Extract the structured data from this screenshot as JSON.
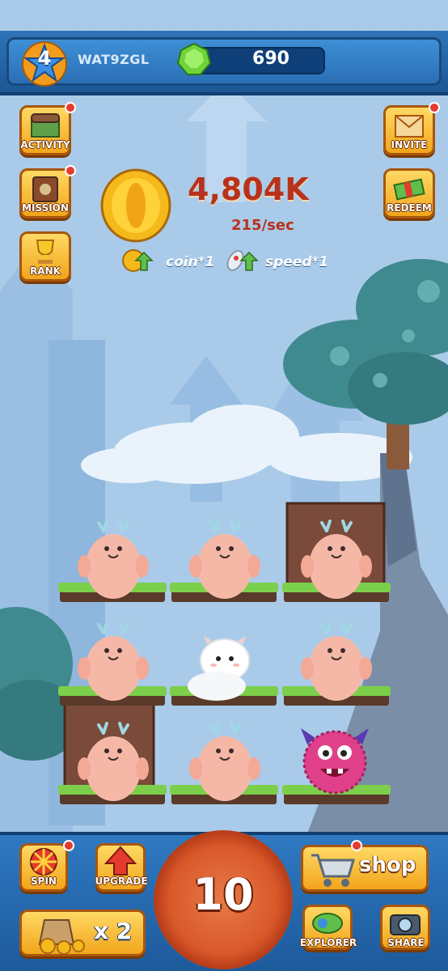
{
  "player": {
    "level": "4",
    "name": "WAT9ZGL",
    "gems": "690"
  },
  "side_left": {
    "activity": "ACTIVITY",
    "mission": "MISSION",
    "rank": "RANK"
  },
  "side_right": {
    "invite": "INVITE",
    "redeem": "REDEEM"
  },
  "coins": {
    "total": "4,804K",
    "rate": "215/sec",
    "coin_boost": "coin*1",
    "speed_boost": "speed*1"
  },
  "bottom": {
    "spin": "SPIN",
    "upgrade": "UPGRADE",
    "tap_count": "10",
    "shop": "shop",
    "multiplier": "x 2",
    "explorer": "EXPLORER",
    "share": "SHARE"
  },
  "monsters": [
    "pink-antler-monster",
    "pink-antler-monster",
    "pink-antler-monster",
    "pink-antler-monster",
    "white-fluffy-monster",
    "pink-antler-monster",
    "pink-antler-monster",
    "pink-antler-monster",
    "purple-furry-monster"
  ],
  "colors": {
    "accent": "#b8321b",
    "button": "#f2a51c",
    "bar": "#2f73b8"
  }
}
